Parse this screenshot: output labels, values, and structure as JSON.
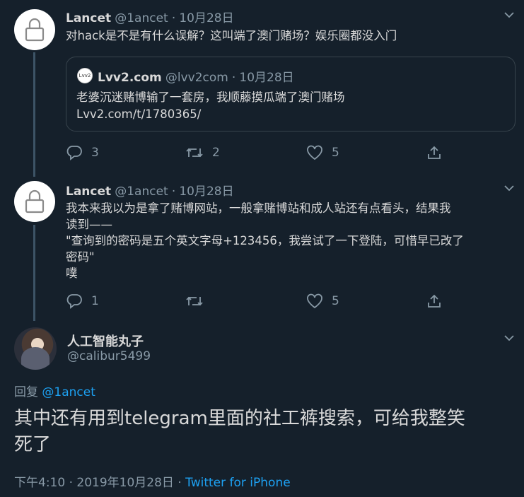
{
  "tweets": [
    {
      "name": "Lancet",
      "handle": "@1ancet",
      "date": "10月28日",
      "text": "对hack是不是有什么误解？这叫端了澳门赌场？娱乐圈都没入门",
      "quoted": {
        "logo_text": "Lvv2",
        "name": "Lvv2.com",
        "handle": "@lvv2com",
        "date": "10月28日",
        "line1": "老婆沉迷赌博输了一套房，我顺藤摸瓜端了澳门赌场",
        "line2": "Lvv2.com/t/1780365/"
      },
      "replies": "3",
      "retweets": "2",
      "likes": "5"
    },
    {
      "name": "Lancet",
      "handle": "@1ancet",
      "date": "10月28日",
      "lines": [
        "我本来我以为是拿了赌博网站，一般拿赌博站和成人站还有点看头，结果我",
        "读到——",
        "\"查询到的密码是五个英文字母+123456，我尝试了一下登陆，可惜早已改了",
        "密码\"",
        "噗"
      ],
      "replies": "1",
      "retweets": "",
      "likes": "5"
    }
  ],
  "main": {
    "name": "人工智能丸子",
    "handle": "@calibur5499",
    "reply_prefix": "回复",
    "reply_to": "@1ancet",
    "text_line1": "其中还有用到telegram里面的社工裤搜索，可给我整笑",
    "text_line2": "死了",
    "time_date": "下午4:10 · 2019年10月28日 · ",
    "source": "Twitter for iPhone"
  },
  "colors": {
    "background": "#15202b",
    "text": "#d9d9d9",
    "secondary": "#8899a6",
    "link": "#1da1f2",
    "border": "#38444d"
  },
  "icons": [
    "lock-icon",
    "chevron-down-icon",
    "reply-icon",
    "retweet-icon",
    "like-icon",
    "share-icon"
  ]
}
